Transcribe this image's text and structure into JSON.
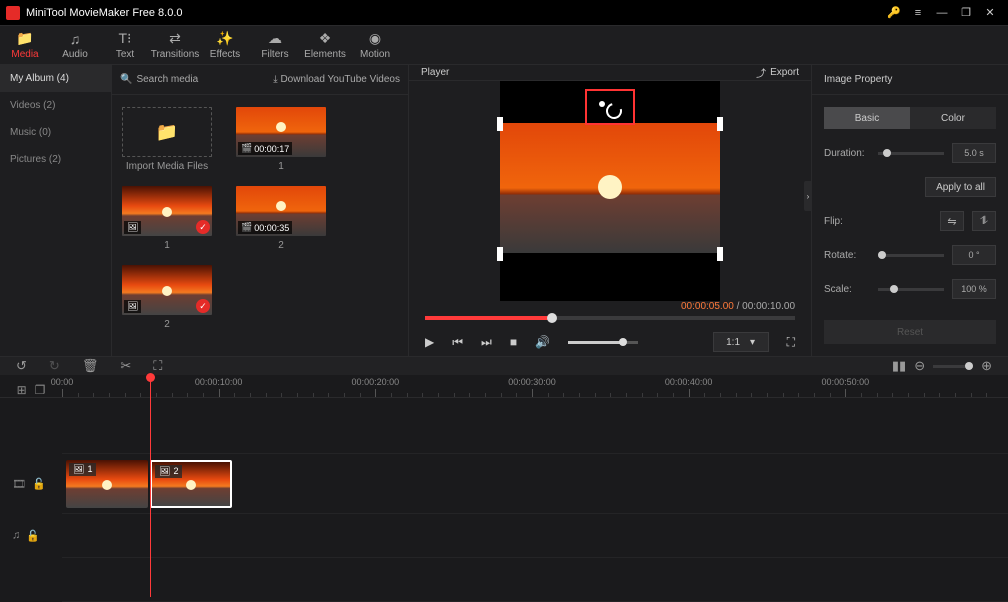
{
  "title": "MiniTool MovieMaker Free 8.0.0",
  "topTabs": [
    {
      "id": "media",
      "label": "Media"
    },
    {
      "id": "audio",
      "label": "Audio"
    },
    {
      "id": "text",
      "label": "Text"
    },
    {
      "id": "transitions",
      "label": "Transitions"
    },
    {
      "id": "effects",
      "label": "Effects"
    },
    {
      "id": "filters",
      "label": "Filters"
    },
    {
      "id": "elements",
      "label": "Elements"
    },
    {
      "id": "motion",
      "label": "Motion"
    }
  ],
  "library": {
    "items": [
      {
        "label": "My Album (4)",
        "active": true
      },
      {
        "label": "Videos (2)"
      },
      {
        "label": "Music (0)"
      },
      {
        "label": "Pictures (2)"
      }
    ]
  },
  "mediaHead": {
    "search": "Search media",
    "download": "Download YouTube Videos"
  },
  "mediaGrid": {
    "importLabel": "Import Media Files",
    "items": [
      {
        "caption": "1",
        "type": "video",
        "duration": "00:00:17"
      },
      {
        "caption": "1",
        "type": "image",
        "checked": true
      },
      {
        "caption": "2",
        "type": "video",
        "duration": "00:00:35"
      },
      {
        "caption": "2",
        "type": "image",
        "checked": true
      }
    ]
  },
  "player": {
    "title": "Player",
    "export": "Export",
    "current": "00:00:05.00",
    "total": "00:00:10.00",
    "ratio": "1:1"
  },
  "props": {
    "title": "Image Property",
    "tabs": {
      "basic": "Basic",
      "color": "Color"
    },
    "duration": {
      "label": "Duration:",
      "value": "5.0 s"
    },
    "applyAll": "Apply to all",
    "flip": {
      "label": "Flip:"
    },
    "rotate": {
      "label": "Rotate:",
      "value": "0 °"
    },
    "scale": {
      "label": "Scale:",
      "value": "100 %"
    },
    "reset": "Reset"
  },
  "ruler": [
    "00:00",
    "00:00:10:00",
    "00:00:20:00",
    "00:00:30:00",
    "00:00:40:00",
    "00:00:50:00"
  ],
  "clips": [
    {
      "num": "1"
    },
    {
      "num": "2"
    }
  ]
}
